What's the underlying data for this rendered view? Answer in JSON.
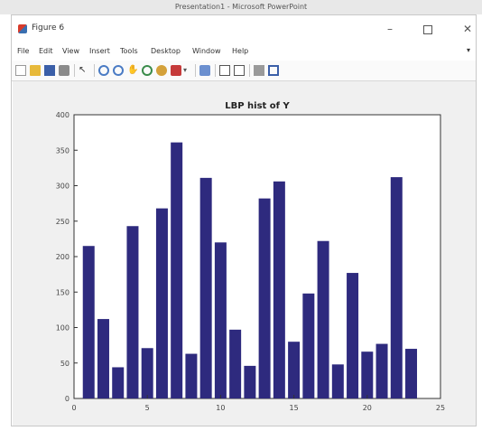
{
  "outer_window": {
    "title": "Presentation1 - Microsoft PowerPoint"
  },
  "window": {
    "title": "Figure 6"
  },
  "menu": [
    "File",
    "Edit",
    "View",
    "Insert",
    "Tools",
    "Desktop",
    "Window",
    "Help"
  ],
  "toolbar_icons": [
    "new-figure-icon",
    "open-file-icon",
    "save-icon",
    "print-icon",
    "edit-plot-icon",
    "zoom-in-icon",
    "zoom-out-icon",
    "pan-icon",
    "rotate-3d-icon",
    "data-cursor-icon",
    "brush-icon",
    "link-plot-icon",
    "insert-colorbar-icon",
    "insert-legend-icon",
    "hide-plot-tools-icon",
    "show-plot-tools-icon"
  ],
  "chart_data": {
    "type": "bar",
    "title": "LBP hist of Y",
    "x": [
      1,
      2,
      3,
      4,
      5,
      6,
      7,
      8,
      9,
      10,
      11,
      12,
      13,
      14,
      15,
      16,
      17,
      18,
      19,
      20,
      21,
      22,
      23
    ],
    "values": [
      215,
      112,
      44,
      243,
      71,
      268,
      361,
      63,
      311,
      220,
      97,
      46,
      282,
      306,
      80,
      148,
      222,
      48,
      177,
      66,
      77,
      312,
      70
    ],
    "xlim": [
      0,
      25
    ],
    "ylim": [
      0,
      400
    ],
    "xticks": [
      0,
      5,
      10,
      15,
      20,
      25
    ],
    "yticks": [
      0,
      50,
      100,
      150,
      200,
      250,
      300,
      350,
      400
    ],
    "bar_color": "#2e2a7e",
    "grid": false
  }
}
